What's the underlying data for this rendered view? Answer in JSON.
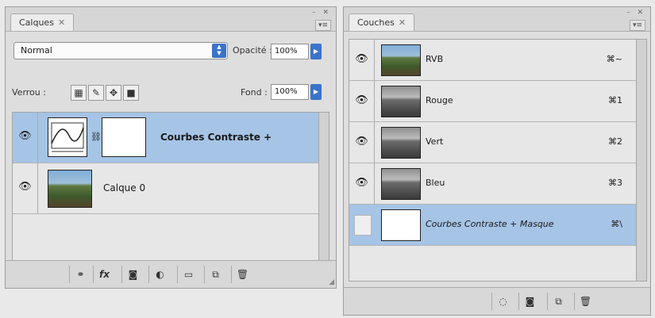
{
  "calques": {
    "tab_label": "Calques",
    "tab_close": "✕",
    "window_controls": "– ✕",
    "menu_icon": "▾≡",
    "blend_mode": "Normal",
    "opacity_label": "Opacité :",
    "opacity_value": "100%",
    "lock_label": "Verrou :",
    "fill_label": "Fond :",
    "fill_value": "100%",
    "layers": [
      {
        "name": "Courbes Contraste +",
        "selected": true,
        "visible": true
      },
      {
        "name": "Calque 0",
        "selected": false,
        "visible": true
      }
    ],
    "footer_icons": [
      "link-icon",
      "fx-icon",
      "mask-icon",
      "adjustment-icon",
      "group-icon",
      "new-layer-icon",
      "trash-icon"
    ]
  },
  "couches": {
    "tab_label": "Couches",
    "tab_close": "✕",
    "window_controls": "– ✕",
    "menu_icon": "▾≡",
    "channels": [
      {
        "name": "RVB",
        "shortcut": "⌘~",
        "visible": true
      },
      {
        "name": "Rouge",
        "shortcut": "⌘1",
        "visible": true
      },
      {
        "name": "Vert",
        "shortcut": "⌘2",
        "visible": true
      },
      {
        "name": "Bleu",
        "shortcut": "⌘3",
        "visible": true
      },
      {
        "name": "Courbes Contraste + Masque",
        "shortcut": "⌘\\",
        "visible": false,
        "selected": true
      }
    ],
    "footer_icons": [
      "load-selection-icon",
      "save-selection-icon",
      "new-channel-icon",
      "trash-icon"
    ]
  }
}
